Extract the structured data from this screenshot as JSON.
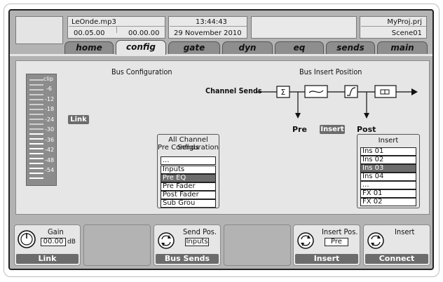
{
  "header": {
    "file_name": "LeOnde.mp3",
    "time_a": "00.05.00",
    "time_b": "00.00.00",
    "clock": "13:44:43",
    "date": "29 November 2010",
    "project": "MyProj.prj",
    "scene": "Scene01"
  },
  "tabs": [
    {
      "label": "home",
      "active": false
    },
    {
      "label": "config",
      "active": true
    },
    {
      "label": "gate",
      "active": false
    },
    {
      "label": "dyn",
      "active": false
    },
    {
      "label": "eq",
      "active": false
    },
    {
      "label": "sends",
      "active": false
    },
    {
      "label": "main",
      "active": false
    }
  ],
  "main": {
    "bus_config_title": "Bus Configuration",
    "bus_insert_title": "Bus Insert Position",
    "link_badge": "Link",
    "meter_labels": [
      "clip",
      "-6",
      "-12",
      "-18",
      "-24",
      "-30",
      "-36",
      "-42",
      "-48",
      "-54"
    ],
    "signal_flow": {
      "source": "Channel Sends",
      "pre": "Pre",
      "insert": "Insert",
      "post": "Post",
      "sum_symbol": "Σ"
    },
    "channel_sends_list": {
      "header_line1": "All Channel Sends",
      "header_line2": "Pre Configuration",
      "items": [
        "...",
        "Inputs",
        "Pre EQ",
        "Pre Fader",
        "Post Fader",
        "Sub Grou"
      ],
      "selected_index": 2
    },
    "insert_list": {
      "header": "Insert",
      "items": [
        "Ins 01",
        "Ins 02",
        "Ins 03",
        "Ins 04",
        "...",
        "FX 01",
        "FX 02"
      ],
      "selected_index": 2
    }
  },
  "bottom": {
    "gain": {
      "label": "Gain",
      "value": "00.00",
      "unit": "dB",
      "button": "Link"
    },
    "send_pos": {
      "label": "Send Pos.",
      "value": "Inputs",
      "button": "Bus Sends"
    },
    "insert_pos": {
      "label": "Insert Pos.",
      "value": "Pre",
      "button": "Insert"
    },
    "insert": {
      "label": "Insert",
      "button": "Connect"
    }
  },
  "colors": {
    "screen_bg": "#b3b3b3",
    "panel_bg": "#e6e6e6",
    "accent_dark": "#6c6c6c"
  }
}
